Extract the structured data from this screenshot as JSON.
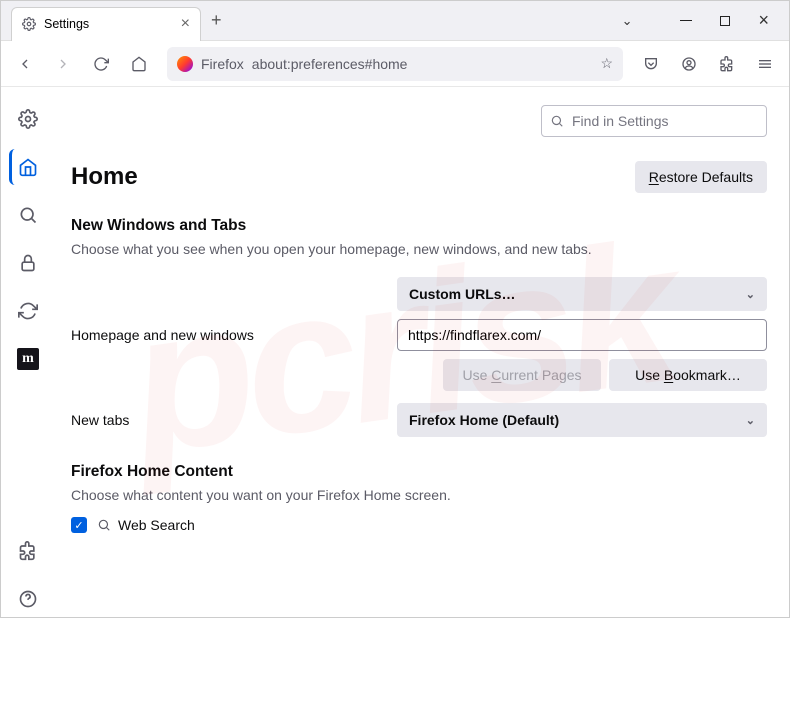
{
  "window": {
    "tab_title": "Settings"
  },
  "urlbar": {
    "brand": "Firefox",
    "path": "about:preferences#home"
  },
  "find": {
    "placeholder": "Find in Settings"
  },
  "page": {
    "title": "Home",
    "restore_btn": "Restore Defaults"
  },
  "sec1": {
    "heading": "New Windows and Tabs",
    "desc": "Choose what you see when you open your homepage, new windows, and new tabs.",
    "row1_label": "Homepage and new windows",
    "row1_select": "Custom URLs…",
    "row1_input": "https://findflarex.com/",
    "btn_current": "Use Current Pages",
    "btn_bookmark": "Use Bookmark…",
    "row2_label": "New tabs",
    "row2_select": "Firefox Home (Default)"
  },
  "sec2": {
    "heading": "Firefox Home Content",
    "desc": "Choose what content you want on your Firefox Home screen.",
    "chk1_label": "Web Search"
  }
}
